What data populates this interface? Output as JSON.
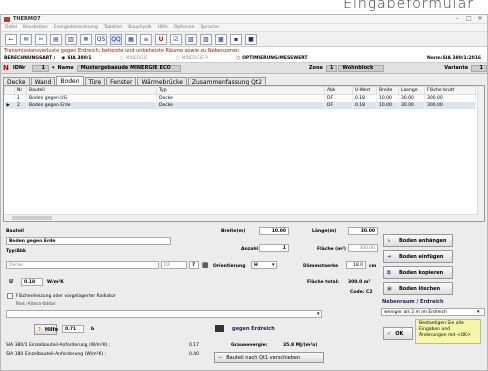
{
  "caption": "Eingabeformular",
  "window": {
    "title": "THERMO7",
    "controls": [
      "–",
      "□",
      "✕"
    ]
  },
  "menus": [
    "Datei",
    "Bearbeiten",
    "Energieberechnung",
    "Tabellen",
    "Bauphysik",
    "Hilfe",
    "Optionen",
    "Sprache"
  ],
  "toolbar": [
    "←",
    "✉",
    "✂",
    "▤",
    "▥",
    "☸",
    "QS",
    "QQ",
    "▦",
    "≡",
    "U",
    "☑",
    "▧",
    "▨",
    "▩",
    "▪",
    "■"
  ],
  "notice": "Transmissionsverluste gegen Erdreich, beheizte und unbeheizte Räume sowie zu Nebenzonen",
  "calc": {
    "label": "BERECHNUNGSART :",
    "options": [
      "SIA 380/1",
      "MINERGIE",
      "MINERGIE-P",
      "OPTIMIERUNG/MESSWERT"
    ],
    "norm": "Norm:SIA 380/1:2016"
  },
  "idbar": {
    "n": "N",
    "id_label": "IDNr",
    "id_value": "1",
    "name_label": "Name",
    "name_value": "Mustergebaeude MINERGIE ECO",
    "zone_label": "Zone",
    "zone_num": "1",
    "zone_name": "Wohnblock",
    "variante_label": "Variante",
    "variante_value": "1"
  },
  "tabs": [
    "Decke",
    "Wand",
    "Boden",
    "Türe",
    "Fenster",
    "Wärmebrücke",
    "Zusammenfassung Qt2"
  ],
  "grid": {
    "columns": [
      "Nr",
      "Bauteil",
      "Typ",
      "Abk",
      "U-Wert",
      "Breite",
      "Laenge",
      "Fläche brutt"
    ],
    "rows": [
      [
        "1",
        "Boden gegen UG",
        "Decke",
        "DF",
        "0.18",
        "10.00",
        "30.00",
        "300.00"
      ],
      [
        "2",
        "Boden gegen Erde",
        "Decke",
        "DF",
        "0.18",
        "10.00",
        "30.00",
        "300.00"
      ]
    ]
  },
  "form": {
    "bauteil_label": "Bauteil",
    "bauteil_value": "Boden gegen Erde",
    "typ_label": "Typ/Abk",
    "typ_value": "Decke",
    "abk_value": "DF",
    "abk_num": "7",
    "u_label": "U",
    "u_value": "0.18",
    "u_unit": "W/m²K",
    "checkbox_label": "Flächenheizung oder vorgelagerter Radiator",
    "redfaktor_label": "Red.-Altera-faktor",
    "hilfe": "Hilfe",
    "b_value": "0.71",
    "b_label": "b",
    "breite_label": "Breite(m)",
    "breite_value": "10.00",
    "laenge_label": "Länge(m)",
    "laenge_value": "30.00",
    "anzahl_label": "Anzahl",
    "anzahl_value": "1",
    "flaeche_label": "Fläche (m²)",
    "flaeche_value": "300.00",
    "orient_label": "Orientierung",
    "orient_value": "H",
    "daemm_label": "Dämmstaerke",
    "daemm_value": "18.0",
    "daemm_unit": "cm",
    "flaeche_total_label": "Fläche total:",
    "flaeche_total_value": "300.0 m²",
    "code": "Code: C2",
    "gegen_erdreich": "gegen Erdreich",
    "sia1": "SIA 380/1 Einzelbauteil-Anforderung (W/m²K) :",
    "sia1_val": "0.17",
    "sia2": "SIA 180 Einzelbauteil-Anforderung (W/m²K) :",
    "sia2_val": "0.40",
    "graue_label": "Graueenergie:",
    "graue_value": "35.8 MJ/(m²a)",
    "verschieben": "Bauteil nach Qt1 verschieben"
  },
  "buttons": {
    "anhaengen": "Boden anhängen",
    "einfuegen": "Boden einfügen",
    "kopieren": "Boden kopieren",
    "loeschen": "Boden löschen",
    "ok": "OK"
  },
  "nebenraum": {
    "label": "Nebenraum / Erdreich",
    "value": "weniger als 2 m im Erdreich",
    "hint": "Bestaetigen Sie alle Eingaben und Änderungen mit <OK>"
  }
}
